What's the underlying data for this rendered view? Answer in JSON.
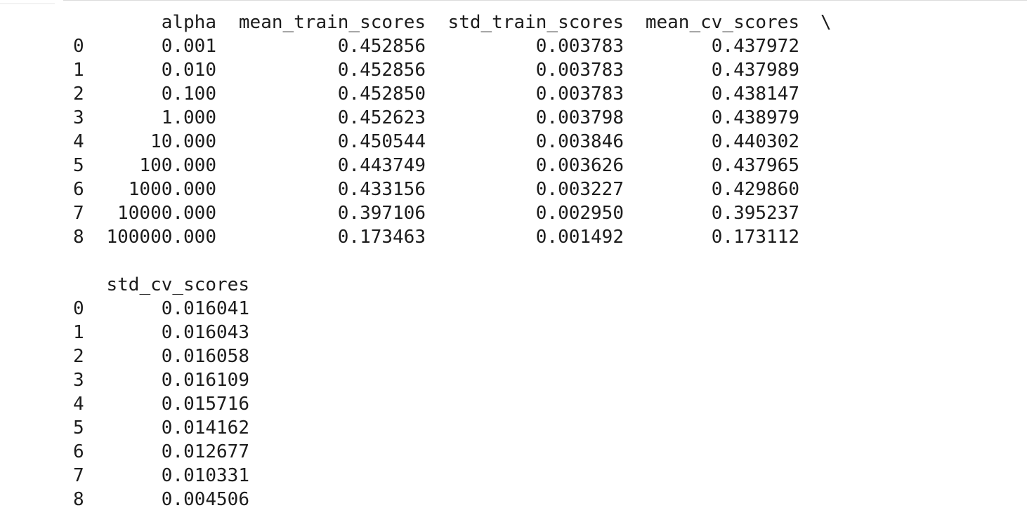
{
  "table1": {
    "headers": [
      "alpha",
      "mean_train_scores",
      "std_train_scores",
      "mean_cv_scores"
    ],
    "continuation": "\\",
    "rows": [
      {
        "index": "0",
        "alpha": "0.001",
        "mean_train_scores": "0.452856",
        "std_train_scores": "0.003783",
        "mean_cv_scores": "0.437972"
      },
      {
        "index": "1",
        "alpha": "0.010",
        "mean_train_scores": "0.452856",
        "std_train_scores": "0.003783",
        "mean_cv_scores": "0.437989"
      },
      {
        "index": "2",
        "alpha": "0.100",
        "mean_train_scores": "0.452850",
        "std_train_scores": "0.003783",
        "mean_cv_scores": "0.438147"
      },
      {
        "index": "3",
        "alpha": "1.000",
        "mean_train_scores": "0.452623",
        "std_train_scores": "0.003798",
        "mean_cv_scores": "0.438979"
      },
      {
        "index": "4",
        "alpha": "10.000",
        "mean_train_scores": "0.450544",
        "std_train_scores": "0.003846",
        "mean_cv_scores": "0.440302"
      },
      {
        "index": "5",
        "alpha": "100.000",
        "mean_train_scores": "0.443749",
        "std_train_scores": "0.003626",
        "mean_cv_scores": "0.437965"
      },
      {
        "index": "6",
        "alpha": "1000.000",
        "mean_train_scores": "0.433156",
        "std_train_scores": "0.003227",
        "mean_cv_scores": "0.429860"
      },
      {
        "index": "7",
        "alpha": "10000.000",
        "mean_train_scores": "0.397106",
        "std_train_scores": "0.002950",
        "mean_cv_scores": "0.395237"
      },
      {
        "index": "8",
        "alpha": "100000.000",
        "mean_train_scores": "0.173463",
        "std_train_scores": "0.001492",
        "mean_cv_scores": "0.173112"
      }
    ]
  },
  "table2": {
    "headers": [
      "std_cv_scores"
    ],
    "rows": [
      {
        "index": "0",
        "std_cv_scores": "0.016041"
      },
      {
        "index": "1",
        "std_cv_scores": "0.016043"
      },
      {
        "index": "2",
        "std_cv_scores": "0.016058"
      },
      {
        "index": "3",
        "std_cv_scores": "0.016109"
      },
      {
        "index": "4",
        "std_cv_scores": "0.015716"
      },
      {
        "index": "5",
        "std_cv_scores": "0.014162"
      },
      {
        "index": "6",
        "std_cv_scores": "0.012677"
      },
      {
        "index": "7",
        "std_cv_scores": "0.010331"
      },
      {
        "index": "8",
        "std_cv_scores": "0.004506"
      }
    ]
  }
}
